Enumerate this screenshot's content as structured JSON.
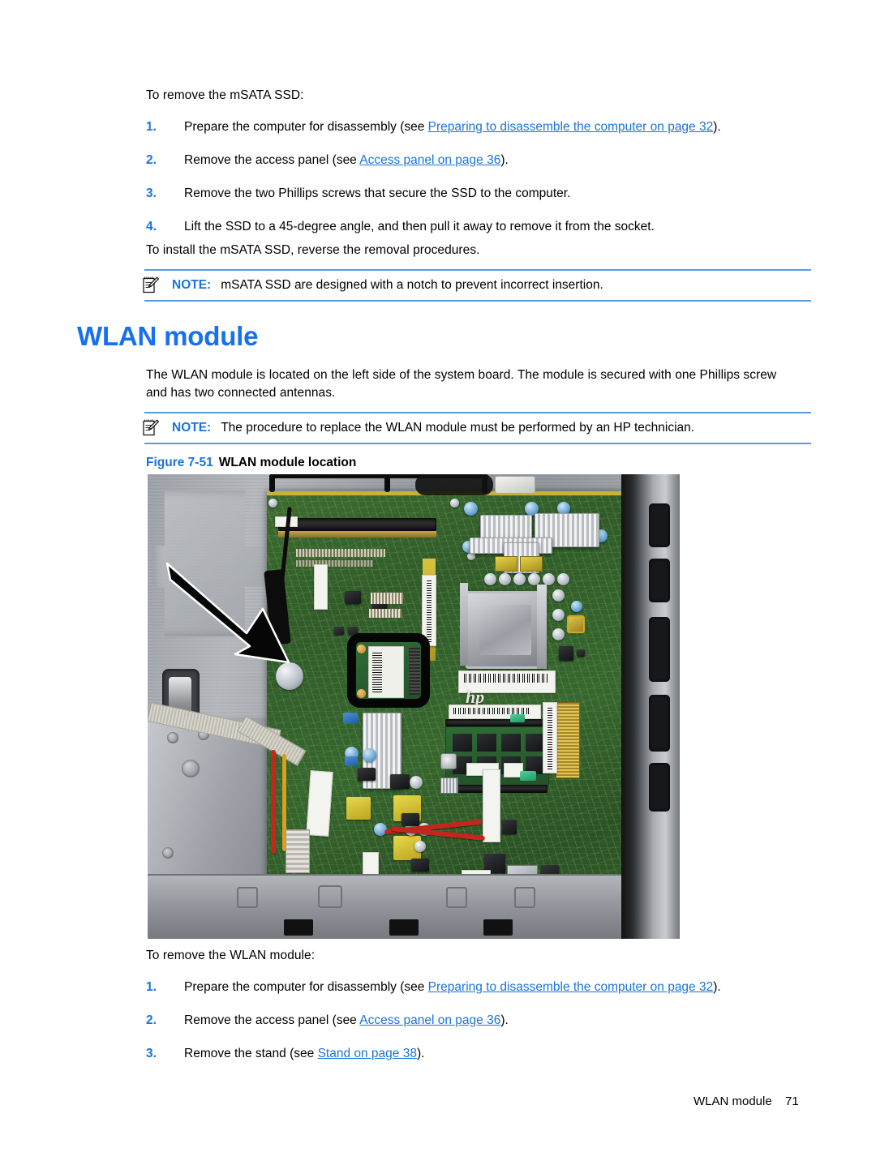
{
  "document": {
    "intro_msata": "To remove the mSATA SSD:",
    "msata_steps": [
      {
        "num": "1.",
        "pre": "Prepare the computer for disassembly (see ",
        "link": "Preparing to disassemble the computer on page 32",
        "post": ")."
      },
      {
        "num": "2.",
        "pre": "Remove the access panel (see ",
        "link": "Access panel on page 36",
        "post": ")."
      },
      {
        "num": "3.",
        "pre": "Remove the two Phillips screws that secure the SSD to the computer.",
        "link": "",
        "post": ""
      },
      {
        "num": "4.",
        "pre": "Lift the SSD to a 45-degree angle, and then pull it away to remove it from the socket.",
        "link": "",
        "post": ""
      }
    ],
    "install_msata": "To install the mSATA SSD, reverse the removal procedures.",
    "note_1": {
      "label": "NOTE:",
      "text": "mSATA SSD are designed with a notch to prevent incorrect insertion.",
      "icon": "note-pencil-icon"
    },
    "heading": "WLAN module",
    "body_paragraph": "The WLAN module is located on the left side of the system board. The module is secured with one Phillips screw and has two connected antennas.",
    "note_2": {
      "label": "NOTE:",
      "text": "The procedure to replace the WLAN module must be performed by an HP technician.",
      "icon": "note-pencil-icon"
    },
    "figure": {
      "number": "Figure 7-51",
      "title": "WLAN module location",
      "alt": "Photograph of an all-in-one computer system board with the WLAN module highlighted by a black rounded rectangle and indicated by a large black arrow",
      "callout_icons": [
        "arrow-icon",
        "highlight-box-icon"
      ],
      "board_marking": "hp"
    },
    "intro_wlan": "To remove the WLAN module:",
    "wlan_steps": [
      {
        "num": "1.",
        "pre": "Prepare the computer for disassembly (see ",
        "link": "Preparing to disassemble the computer on page 32",
        "post": ")."
      },
      {
        "num": "2.",
        "pre": "Remove the access panel (see ",
        "link": "Access panel on page 36",
        "post": ")."
      },
      {
        "num": "3.",
        "pre": "Remove the stand (see ",
        "link": "Stand on page 38",
        "post": ")."
      }
    ],
    "footer": {
      "section": "WLAN module",
      "page_number": "71"
    },
    "colors": {
      "link": "#1a74d8",
      "heading": "#1770ee",
      "note_rule": "#5b9bdc",
      "text": "#000000"
    }
  }
}
